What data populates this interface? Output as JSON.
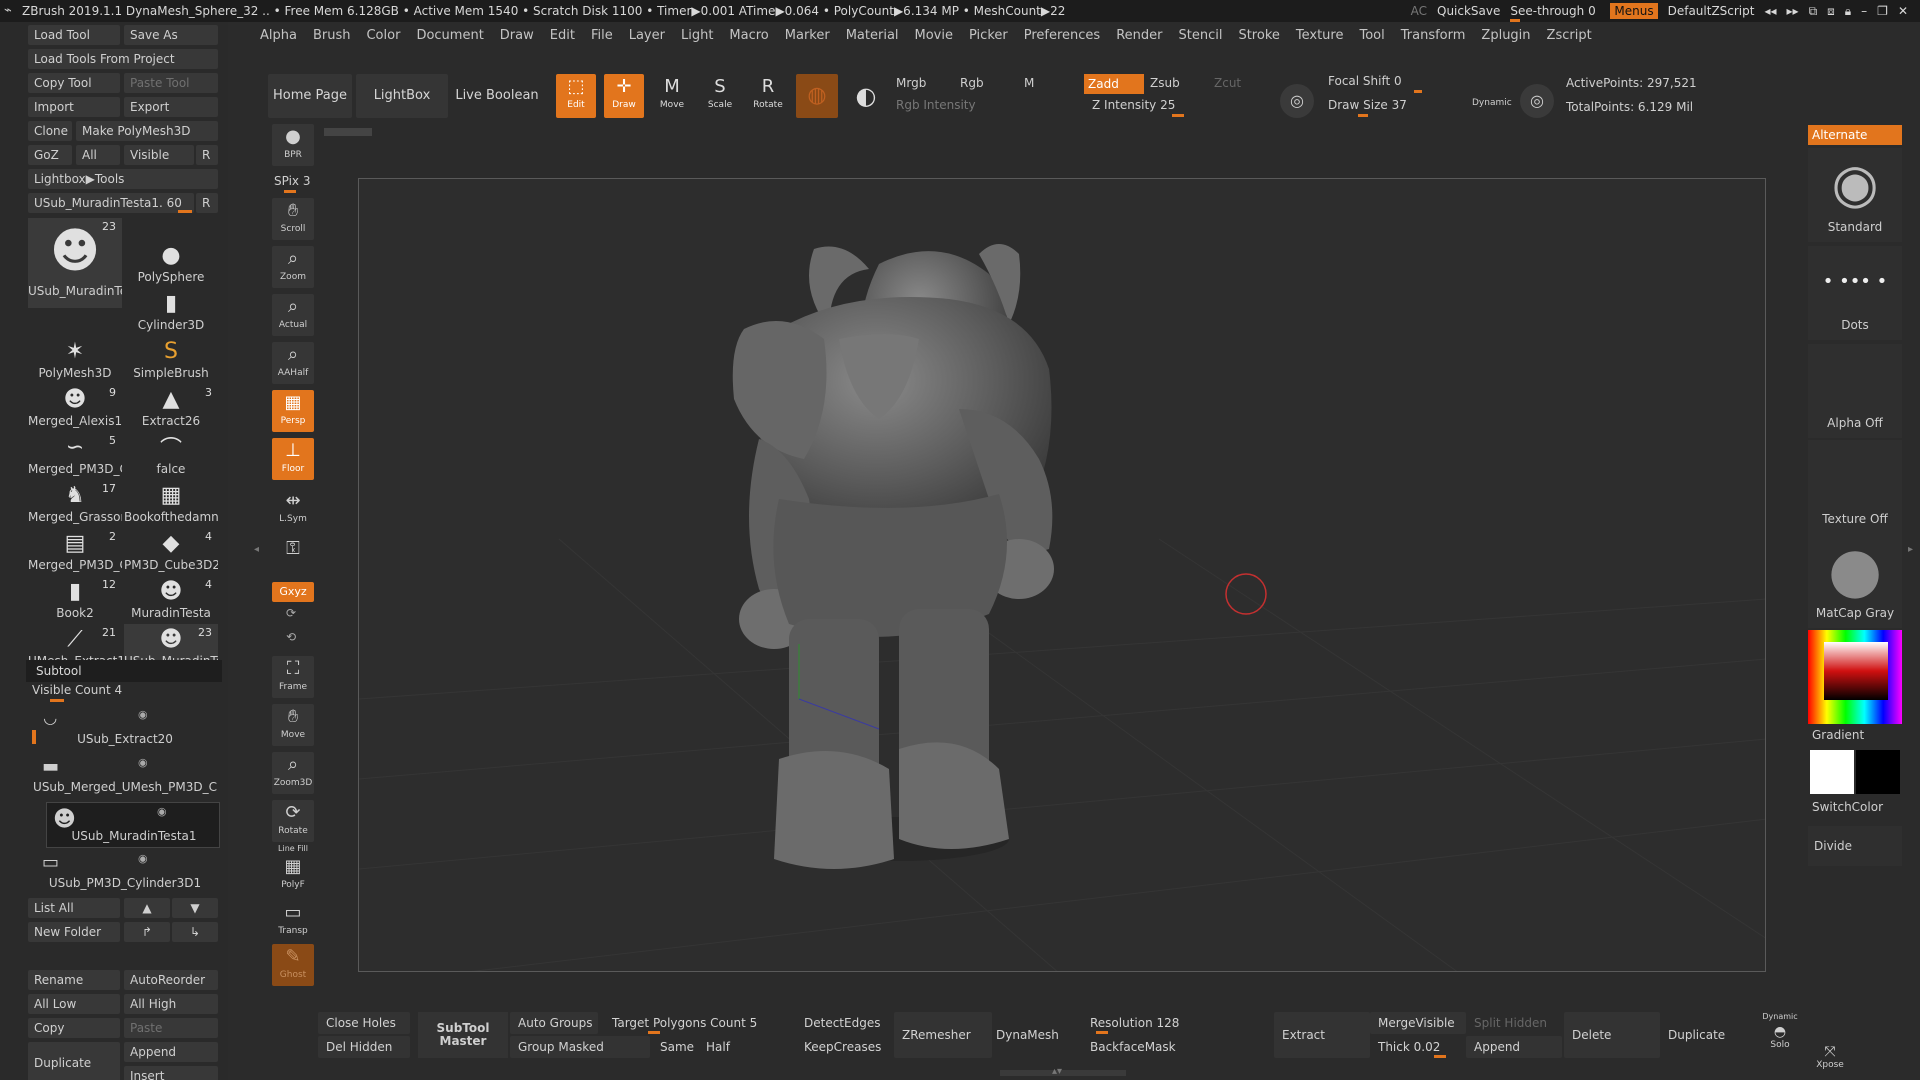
{
  "titlebar": {
    "text": "ZBrush 2019.1.1    DynaMesh_Sphere_32   .. • Free Mem 6.128GB • Active Mem 1540 • Scratch Disk 1100 • Timer▶0.001 ATime▶0.064 • PolyCount▶6.134 MP   • MeshCount▶22",
    "ac": "AC",
    "quicksave": "QuickSave",
    "seethrough": "See-through  0",
    "menus": "Menus",
    "script": "DefaultZScript"
  },
  "menubar": [
    "Alpha",
    "Brush",
    "Color",
    "Document",
    "Draw",
    "Edit",
    "File",
    "Layer",
    "Light",
    "Macro",
    "Marker",
    "Material",
    "Movie",
    "Picker",
    "Preferences",
    "Render",
    "Stencil",
    "Stroke",
    "Texture",
    "Tool",
    "Transform",
    "Zplugin",
    "Zscript"
  ],
  "left": {
    "load_tool": "Load Tool",
    "save_as": "Save As",
    "load_from_project": "Load Tools From Project",
    "copy_tool": "Copy Tool",
    "paste_tool": "Paste Tool",
    "import": "Import",
    "export": "Export",
    "clone": "Clone",
    "make_polymesh": "Make PolyMesh3D",
    "goz": "GoZ",
    "all": "All",
    "visible": "Visible",
    "r": "R",
    "lightbox_tools": "Lightbox▶Tools",
    "current_tool": "USub_MuradinTesta1. 60",
    "r2": "R",
    "thumbs": [
      {
        "label": "USub_MuradinTe",
        "count": "23",
        "icon": "☻"
      },
      {
        "label": "PolySphere",
        "count": "",
        "icon": "●"
      },
      {
        "label": "Cylinder3D",
        "count": "",
        "icon": "▮"
      },
      {
        "label": "PolyMesh3D",
        "count": "",
        "icon": "✶"
      },
      {
        "label": "SimpleBrush",
        "count": "",
        "icon": "S"
      },
      {
        "label": "Merged_Alexis1",
        "count": "9",
        "icon": "☻"
      },
      {
        "label": "Extract26",
        "count": "3",
        "icon": "▲"
      },
      {
        "label": "Merged_PM3D_C",
        "count": "5",
        "icon": "∽"
      },
      {
        "label": "falce",
        "count": "",
        "icon": "⌒"
      },
      {
        "label": "Merged_Grassor",
        "count": "17",
        "icon": "♞"
      },
      {
        "label": "Bookofthedamne",
        "count": "",
        "icon": "▦"
      },
      {
        "label": "Merged_PM3D_C",
        "count": "2",
        "icon": "▤"
      },
      {
        "label": "PM3D_Cube3D2",
        "count": "4",
        "icon": "◆"
      },
      {
        "label": "Book2",
        "count": "12",
        "icon": "▮"
      },
      {
        "label": "MuradinTesta",
        "count": "4",
        "icon": "☻"
      },
      {
        "label": "UMesh_Extract1",
        "count": "21",
        "icon": "⟋"
      },
      {
        "label": "USub_MuradinTe",
        "count": "23",
        "icon": "☻"
      }
    ],
    "subtool_header": "Subtool",
    "visible_count": "Visible Count 4",
    "subtools": [
      "USub_Extract20",
      "USub_Merged_UMesh_PM3D_C",
      "USub_MuradinTesta1",
      "USub_PM3D_Cylinder3D1"
    ],
    "list_all": "List All",
    "new_folder": "New Folder",
    "rename": "Rename",
    "autoreorder": "AutoReorder",
    "all_low": "All Low",
    "all_high": "All High",
    "copy": "Copy",
    "paste": "Paste",
    "duplicate": "Duplicate",
    "append": "Append",
    "insert": "Insert"
  },
  "toolbar": {
    "home": "Home Page",
    "lightbox": "LightBox",
    "live_boolean": "Live Boolean",
    "edit": "Edit",
    "draw": "Draw",
    "move": "Move",
    "scale": "Scale",
    "rotate": "Rotate",
    "mrgb": "Mrgb",
    "rgb": "Rgb",
    "m": "M",
    "zadd": "Zadd",
    "zsub": "Zsub",
    "zcut": "Zcut",
    "rgb_intensity": "Rgb Intensity",
    "z_intensity": "Z Intensity 25",
    "focal_shift": "Focal Shift 0",
    "draw_size": "Draw Size 37",
    "dynamic": "Dynamic",
    "active_points": "ActivePoints: 297,521",
    "total_points": "TotalPoints: 6.129 Mil"
  },
  "vtools": {
    "bpr": "BPR",
    "spix": "SPix 3",
    "scroll": "Scroll",
    "zoom": "Zoom",
    "actual": "Actual",
    "aahalf": "AAHalf",
    "persp": "Persp",
    "floor": "Floor",
    "lsym": "L.Sym",
    "xyz": "Gxyz",
    "frame": "Frame",
    "move": "Move",
    "zoom3d": "Zoom3D",
    "rotate": "Rotate",
    "polyf": "PolyF",
    "linefill": "Line Fill",
    "transp": "Transp",
    "ghost": "Ghost",
    "dynamic": "Dynamic"
  },
  "right": {
    "alternate": "Alternate",
    "brush": "Standard",
    "stroke": "Dots",
    "alpha": "Alpha Off",
    "texture": "Texture Off",
    "material": "MatCap Gray",
    "gradient": "Gradient",
    "switchcolor": "SwitchColor",
    "divide": "Divide"
  },
  "bottom": {
    "close_holes": "Close Holes",
    "del_hidden": "Del Hidden",
    "subtool_master": "SubTool Master",
    "auto_groups": "Auto Groups",
    "group_masked": "Group Masked",
    "target_poly": "Target Polygons Count 5",
    "same": "Same",
    "half": "Half",
    "detect_edges": "DetectEdges",
    "keep_creases": "KeepCreases",
    "zremesher": "ZRemesher",
    "dynamesh": "DynaMesh",
    "resolution": "Resolution 128",
    "backface_mask": "BackfaceMask",
    "extract": "Extract",
    "merge_visible": "MergeVisible",
    "split_hidden": "Split Hidden",
    "thick": "Thick 0.02",
    "append": "Append",
    "delete": "Delete",
    "duplicate": "Duplicate",
    "solo": "Solo",
    "dynamic": "Dynamic",
    "xpose": "Xpose"
  },
  "colors": {
    "accent": "#e2751d",
    "bg": "#2b2b2b"
  }
}
